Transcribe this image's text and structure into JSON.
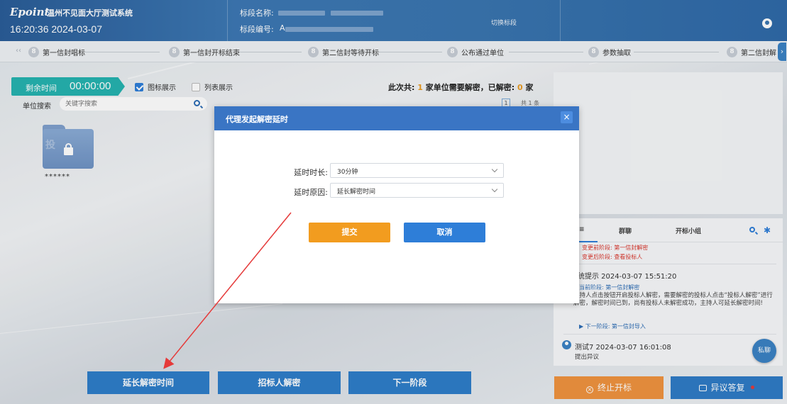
{
  "header": {
    "logo": "Epoint",
    "system_title": "温州不见面大厅测试系统",
    "clock": "16:20:36 2024-03-07",
    "section_name_label": "标段名称:",
    "section_code_label": "标段编号:",
    "section_code_prefix": "A",
    "switch_label": "切换标段"
  },
  "steps": [
    {
      "num": "8",
      "label": "第一信封唱标"
    },
    {
      "num": "8",
      "label": "第一信封开标结束"
    },
    {
      "num": "8",
      "label": "第二信封等待开标"
    },
    {
      "num": "8",
      "label": "公布通过单位"
    },
    {
      "num": "8",
      "label": "参数抽取"
    },
    {
      "num": "8",
      "label": "第二信封解"
    }
  ],
  "left": {
    "timer_label": "剩余时间",
    "timer_value": "00:00:00",
    "icon_view_label": "图标展示",
    "list_view_label": "列表展示",
    "summary_prefix": "此次共:",
    "summary_count": "1",
    "summary_mid": "家单位需要解密，已解密:",
    "summary_decrypted": "0",
    "summary_suffix": "家",
    "search_label": "单位搜索",
    "search_placeholder": "关键字搜索",
    "page_current": "1",
    "page_total": "共 1 条",
    "folder_seal": "投",
    "folder_name": "******"
  },
  "chat": {
    "tab_group": "群聊",
    "tab_team": "开标小组",
    "tab_first": "≡",
    "red_line1": "变更前阶段: 第一信封解密",
    "red_line2": "变更后阶段: 查看投标人",
    "msg1_title": "系统提示  2024-03-07 15:51:20",
    "msg1_stage": "当前阶段: 第一信封解密",
    "msg1_body": "主持人点击按钮开启投标人解密，需要解密的投标人点击“投标人解密”进行解密，解密时间已到，尚有投标人未解密成功，主持人可延长解密时间!",
    "msg1_next": "▶ 下一阶段: 第一信封导入",
    "msg2_title": "测试7  2024-03-07 16:01:08",
    "msg2_body": "提出异议",
    "private_chat": "私聊"
  },
  "buttons": {
    "extend": "延长解密时间",
    "tenderer_decrypt": "招标人解密",
    "next_stage": "下一阶段",
    "stop": "终止开标",
    "objection": "异议答复"
  },
  "modal": {
    "title": "代理发起解密延时",
    "close": "×",
    "duration_label": "延时时长:",
    "duration_value": "30分钟",
    "reason_label": "延时原因:",
    "reason_value": "延长解密时间",
    "submit": "提交",
    "cancel": "取消"
  },
  "colors": {
    "header": "#3a75b0",
    "primary": "#2e7ed8",
    "submit": "#f29c1f",
    "stop": "#f0933f",
    "timer": "#26b3b0",
    "alert": "#d9352b"
  }
}
